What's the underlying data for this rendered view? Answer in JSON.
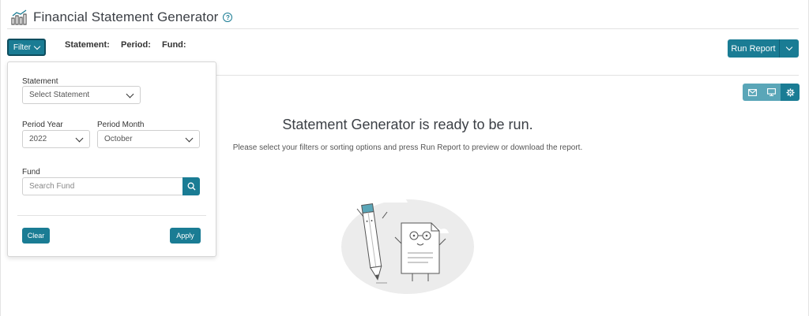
{
  "header": {
    "title": "Financial Statement Generator",
    "help_icon": "?"
  },
  "toolbar": {
    "filter_label": "Filter",
    "criteria": {
      "statement": "Statement:",
      "period": "Period:",
      "fund": "Fund:"
    },
    "run_report_label": "Run Report",
    "icons": [
      "mail-icon",
      "monitor-icon",
      "gear-icon"
    ]
  },
  "filter_panel": {
    "statement_label": "Statement",
    "statement_value": "Select Statement",
    "period_year_label": "Period Year",
    "period_year_value": "2022",
    "period_month_label": "Period Month",
    "period_month_value": "October",
    "fund_label": "Fund",
    "fund_placeholder": "Search Fund",
    "clear_label": "Clear",
    "apply_label": "Apply"
  },
  "empty_state": {
    "title": "Statement Generator is ready to be run.",
    "subtitle": "Please select your filters or sorting options and press Run Report to preview or download the report."
  },
  "colors": {
    "primary": "#1a7c94",
    "primary_light": "#5aa6b8",
    "border": "#cfcfcf"
  }
}
